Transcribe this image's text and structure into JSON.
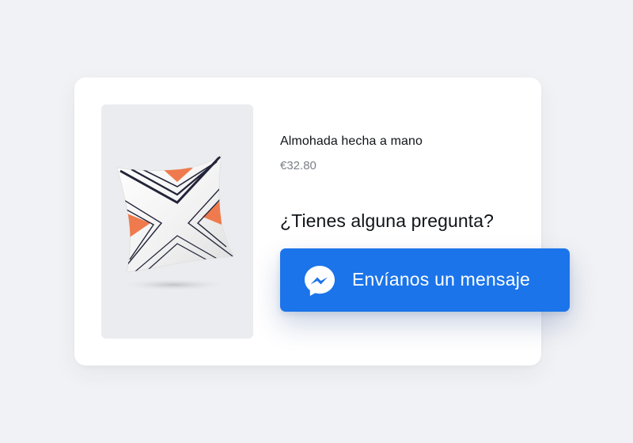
{
  "product": {
    "image_alt": "pillow-image",
    "name": "Almohada hecha a mano",
    "price": "€32.80"
  },
  "cta": {
    "question": "¿Tienes alguna pregunta?",
    "button_label": "Envíanos un mensaje",
    "button_icon": "messenger-icon"
  },
  "colors": {
    "background": "#f1f2f5",
    "card": "#ffffff",
    "image_bg": "#ebecef",
    "button": "#1b74ea",
    "pillow_accent": "#ef7a4d",
    "pillow_lines": "#23243a"
  }
}
